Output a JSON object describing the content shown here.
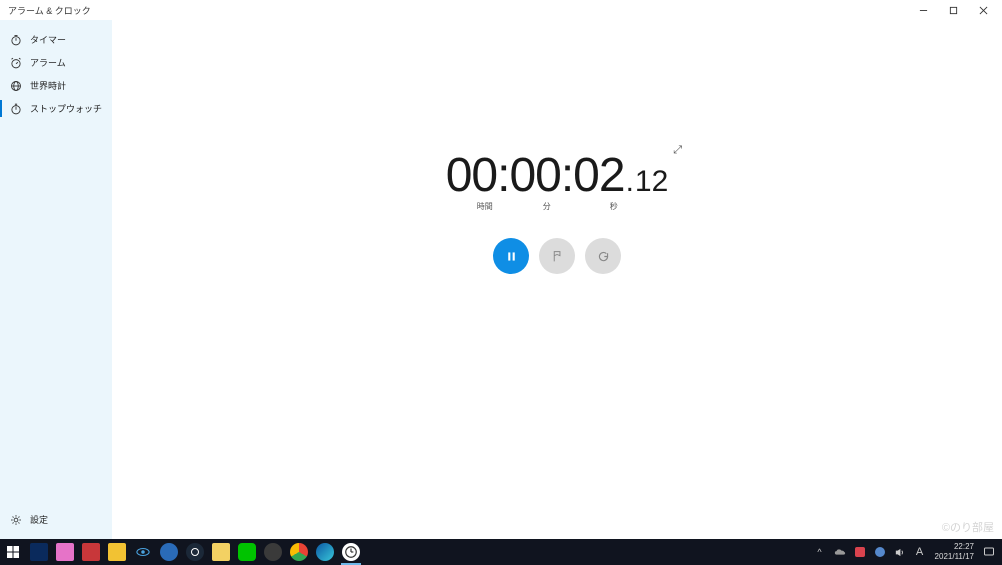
{
  "window": {
    "title": "アラーム & クロック"
  },
  "sidebar": {
    "items": [
      {
        "id": "timer",
        "label": "タイマー"
      },
      {
        "id": "alarm",
        "label": "アラーム"
      },
      {
        "id": "worldclock",
        "label": "世界時計"
      },
      {
        "id": "stopwatch",
        "label": "ストップウォッチ"
      }
    ],
    "settings_label": "設定"
  },
  "stopwatch": {
    "hours": "00",
    "minutes": "00",
    "seconds": "02",
    "centiseconds": "12",
    "labels": {
      "hours": "時間",
      "minutes": "分",
      "seconds": "秒"
    }
  },
  "taskbar": {
    "clock_time": "22:27",
    "clock_date": "2021/11/17",
    "ime": "A"
  },
  "watermark": "©のり部屋",
  "colors": {
    "accent": "#0f8ee5",
    "sidebar_bg": "#ebf6fc"
  }
}
